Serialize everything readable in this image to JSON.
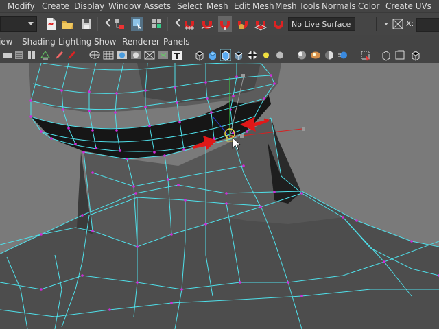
{
  "menubar": {
    "items": [
      "Modify",
      "Create",
      "Display",
      "Window",
      "Assets",
      "Select",
      "Mesh",
      "Edit Mesh",
      "Mesh Tools",
      "Normals",
      "Color",
      "Create UVs"
    ]
  },
  "toolbar": {
    "live_surface_label": "No Live Surface",
    "x_label": "X:"
  },
  "panel_menu": {
    "items": [
      "View",
      "Shading",
      "Lighting",
      "Show",
      "Renderer",
      "Panels"
    ]
  },
  "viewport": {
    "wire_color": "#4fe0ea",
    "vertex_color": "#d02ad8",
    "gizmo_color": "#e6d34a",
    "arrow_color": "#e01818"
  }
}
